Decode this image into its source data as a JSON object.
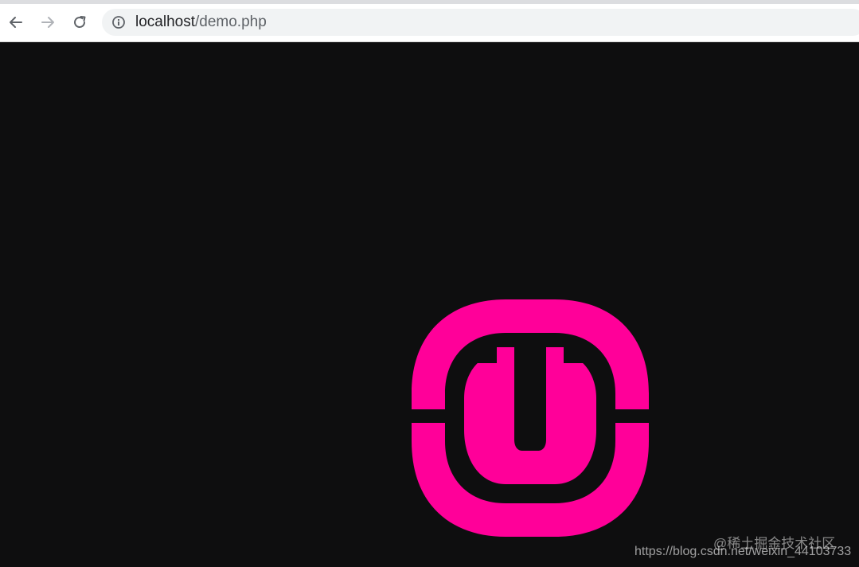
{
  "browser": {
    "back_icon": "arrow-left-icon",
    "forward_icon": "arrow-right-icon",
    "reload_icon": "reload-icon",
    "site_info_icon": "info-circle-icon",
    "url_host": "localhost",
    "url_path": "/demo.php"
  },
  "page": {
    "background_color": "#0e0e0f",
    "logo_color": "#ff0099",
    "logo_icon": "wampserver-logo-icon"
  },
  "watermarks": {
    "line1": "@稀土掘金技术社区",
    "line2": "https://blog.csdn.net/weixin_44103733"
  }
}
